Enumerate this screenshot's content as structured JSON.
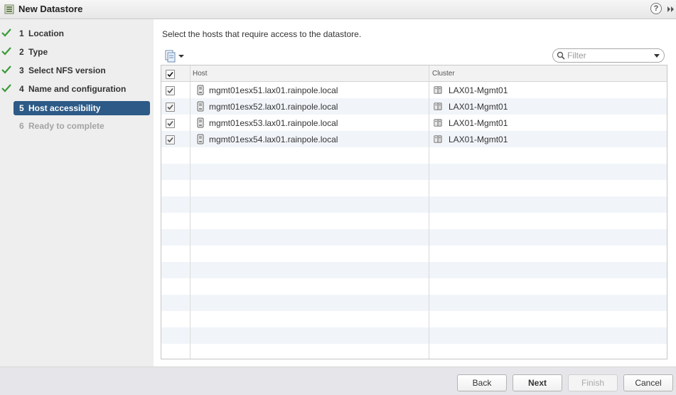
{
  "window": {
    "title": "New Datastore",
    "help_label": "?"
  },
  "nav": {
    "items": [
      {
        "num": "1",
        "label": "Location",
        "state": "done"
      },
      {
        "num": "2",
        "label": "Type",
        "state": "done"
      },
      {
        "num": "3",
        "label": "Select NFS version",
        "state": "done"
      },
      {
        "num": "4",
        "label": "Name and configuration",
        "state": "done"
      },
      {
        "num": "5",
        "label": "Host accessibility",
        "state": "active"
      },
      {
        "num": "6",
        "label": "Ready to complete",
        "state": "disabled"
      }
    ]
  },
  "main": {
    "instruction": "Select the hosts that require access to the datastore.",
    "filter": {
      "placeholder": "Filter",
      "value": ""
    },
    "table": {
      "columns": [
        "Host",
        "Cluster"
      ],
      "select_all_checked": true,
      "rows": [
        {
          "checked": true,
          "host": "mgmt01esx51.lax01.rainpole.local",
          "cluster": "LAX01-Mgmt01"
        },
        {
          "checked": true,
          "host": "mgmt01esx52.lax01.rainpole.local",
          "cluster": "LAX01-Mgmt01"
        },
        {
          "checked": true,
          "host": "mgmt01esx53.lax01.rainpole.local",
          "cluster": "LAX01-Mgmt01"
        },
        {
          "checked": true,
          "host": "mgmt01esx54.lax01.rainpole.local",
          "cluster": "LAX01-Mgmt01"
        }
      ]
    }
  },
  "footer": {
    "back_label": "Back",
    "next_label": "Next",
    "finish_label": "Finish",
    "cancel_label": "Cancel"
  },
  "colors": {
    "active_step": "#2d5a86",
    "check_green": "#3a9a3a",
    "nav_bg": "#eeeeee",
    "row_alt": "#f1f5fa"
  }
}
